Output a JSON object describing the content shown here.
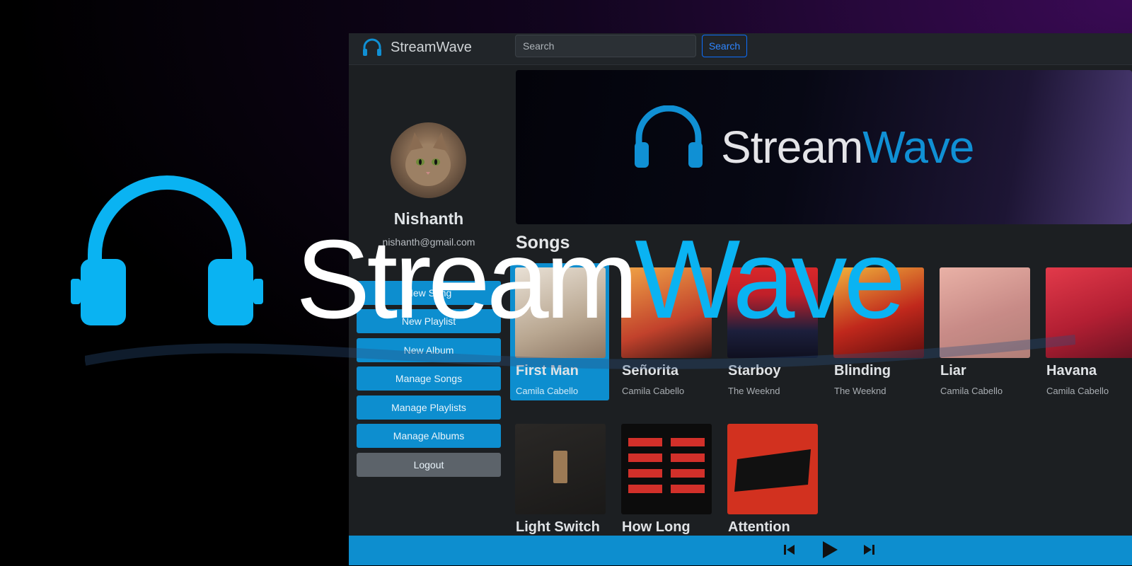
{
  "app": {
    "name": "StreamWave",
    "accent_color": "#0d8ecf"
  },
  "search": {
    "placeholder": "Search",
    "button_label": "Search"
  },
  "user": {
    "name": "Nishanth",
    "email": "nishanth@gmail.com",
    "avatar": "cat-photo"
  },
  "sidebar": {
    "buttons": [
      {
        "label": "New Song"
      },
      {
        "label": "New Playlist"
      },
      {
        "label": "New Album"
      },
      {
        "label": "Manage Songs"
      },
      {
        "label": "Manage Playlists"
      },
      {
        "label": "Manage Albums"
      },
      {
        "label": "Logout"
      }
    ]
  },
  "hero": {
    "brand_white": "Stream",
    "brand_accent": "Wave"
  },
  "songs": {
    "title": "Songs",
    "items": [
      {
        "title": "First Man",
        "artist": "Camila Cabello",
        "selected": true
      },
      {
        "title": "Señorita",
        "artist": "Camila Cabello"
      },
      {
        "title": "Starboy",
        "artist": "The Weeknd"
      },
      {
        "title": "Blinding",
        "artist": "The Weeknd"
      },
      {
        "title": "Liar",
        "artist": "Camila Cabello"
      },
      {
        "title": "Havana",
        "artist": "Camila Cabello"
      },
      {
        "title": "Light Switch",
        "artist": ""
      },
      {
        "title": "How Long",
        "artist": ""
      },
      {
        "title": "Attention",
        "artist": ""
      }
    ]
  },
  "player": {
    "controls": [
      "previous-icon",
      "play-icon",
      "next-icon"
    ]
  },
  "overlay": {
    "brand_white": "Stream",
    "brand_accent": "Wave",
    "color_white": "#ffffff",
    "color_accent": "#0ab3f2"
  }
}
